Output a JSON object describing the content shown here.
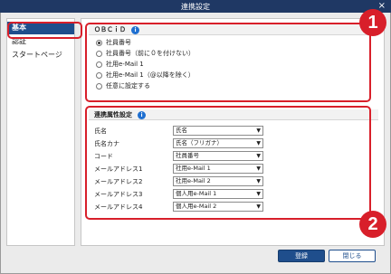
{
  "window": {
    "title": "連携設定",
    "close_glyph": "×"
  },
  "sidebar": {
    "items": [
      {
        "label": "基本"
      },
      {
        "label": "認証"
      },
      {
        "label": "スタートページ"
      }
    ]
  },
  "obcid": {
    "header": "ＯＢＣｉＤ",
    "options": [
      {
        "label": "社員番号",
        "checked": true
      },
      {
        "label": "社員番号（前に０を付けない）",
        "checked": false
      },
      {
        "label": "社用e-Mail 1",
        "checked": false
      },
      {
        "label": "社用e-Mail 1（@以降を除く）",
        "checked": false
      },
      {
        "label": "任意に設定する",
        "checked": false
      }
    ]
  },
  "attributes": {
    "header": "連携属性設定",
    "rows": [
      {
        "label": "氏名",
        "value": "氏名"
      },
      {
        "label": "氏名カナ",
        "value": "氏名（フリガナ）"
      },
      {
        "label": "コード",
        "value": "社員番号"
      },
      {
        "label": "メールアドレス1",
        "value": "社用e-Mail 1"
      },
      {
        "label": "メールアドレス2",
        "value": "社用e-Mail 2"
      },
      {
        "label": "メールアドレス3",
        "value": "個人用e-Mail 1"
      },
      {
        "label": "メールアドレス4",
        "value": "個人用e-Mail 2"
      }
    ]
  },
  "annotations": {
    "badge1": "1",
    "badge2": "2"
  },
  "buttons": {
    "register": "登録",
    "close": "閉じる"
  },
  "icons": {
    "info": "i",
    "caret": "▼"
  },
  "colors": {
    "titlebar": "#1f3864",
    "accent": "#1f4e8c",
    "highlight": "#d81f2a"
  }
}
